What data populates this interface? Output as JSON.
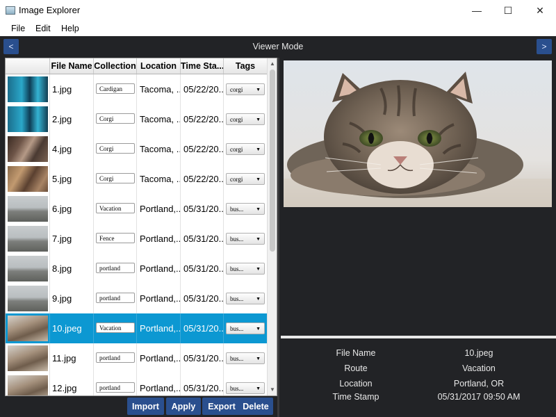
{
  "window": {
    "title": "Image Explorer",
    "minimize_icon": "—",
    "maximize_icon": "☐",
    "close_icon": "✕"
  },
  "menu": {
    "items": [
      "File",
      "Edit",
      "Help"
    ]
  },
  "toolbar": {
    "prev_label": "<",
    "next_label": ">",
    "mode_label": "Viewer Mode"
  },
  "table": {
    "columns": [
      "",
      "File Name",
      "Collection",
      "Location",
      "Time Sta...",
      "Tags"
    ],
    "rows": [
      {
        "thumb": "corgi",
        "file": "1.jpg",
        "collection": "Cardigan",
        "location": "Tacoma, ...",
        "time": "05/22/20...",
        "tag": "corgi"
      },
      {
        "thumb": "corgi",
        "file": "2.jpg",
        "collection": "Corgi",
        "location": "Tacoma, ...",
        "time": "05/22/20...",
        "tag": "corgi"
      },
      {
        "thumb": "selfie",
        "file": "4.jpg",
        "collection": "Corgi",
        "location": "Tacoma, ...",
        "time": "05/22/20...",
        "tag": "corgi"
      },
      {
        "thumb": "dog",
        "file": "5.jpg",
        "collection": "Corgi",
        "location": "Tacoma, ...",
        "time": "05/22/20...",
        "tag": "corgi"
      },
      {
        "thumb": "bus",
        "file": "6.jpg",
        "collection": "Vacation",
        "location": "Portland,...",
        "time": "05/31/20...",
        "tag": "bus..."
      },
      {
        "thumb": "bus",
        "file": "7.jpg",
        "collection": "Fence",
        "location": "Portland,...",
        "time": "05/31/20...",
        "tag": "bus..."
      },
      {
        "thumb": "bus",
        "file": "8.jpg",
        "collection": "portland",
        "location": "Portland,...",
        "time": "05/31/20...",
        "tag": "bus..."
      },
      {
        "thumb": "bus",
        "file": "9.jpg",
        "collection": "portland",
        "location": "Portland,...",
        "time": "05/31/20...",
        "tag": "bus..."
      },
      {
        "thumb": "cat",
        "file": "10.jpeg",
        "collection": "Vacation",
        "location": "Portland,...",
        "time": "05/31/20...",
        "tag": "bus...",
        "selected": true
      },
      {
        "thumb": "cat",
        "file": "11.jpg",
        "collection": "portland",
        "location": "Portland,...",
        "time": "05/31/20...",
        "tag": "bus..."
      },
      {
        "thumb": "cat",
        "file": "12.jpg",
        "collection": "portland",
        "location": "Portland,...",
        "time": "05/31/20...",
        "tag": "bus..."
      }
    ]
  },
  "actions": {
    "import": "Import",
    "apply": "Apply",
    "export": "Export",
    "delete": "Delete"
  },
  "viewer": {
    "image": "tabby-cat-photo"
  },
  "details": {
    "fields": [
      {
        "label": "File Name",
        "value": "10.jpeg"
      },
      {
        "label": "Route",
        "value": "Vacation"
      },
      {
        "label": "Location",
        "value": "Portland, OR"
      },
      {
        "label": "Time Stamp",
        "value": "05/31/2017 09:50 AM"
      }
    ]
  },
  "colors": {
    "panel_bg": "#222326",
    "accent": "#2a4f8e",
    "selected_row": "#0c98d2"
  }
}
